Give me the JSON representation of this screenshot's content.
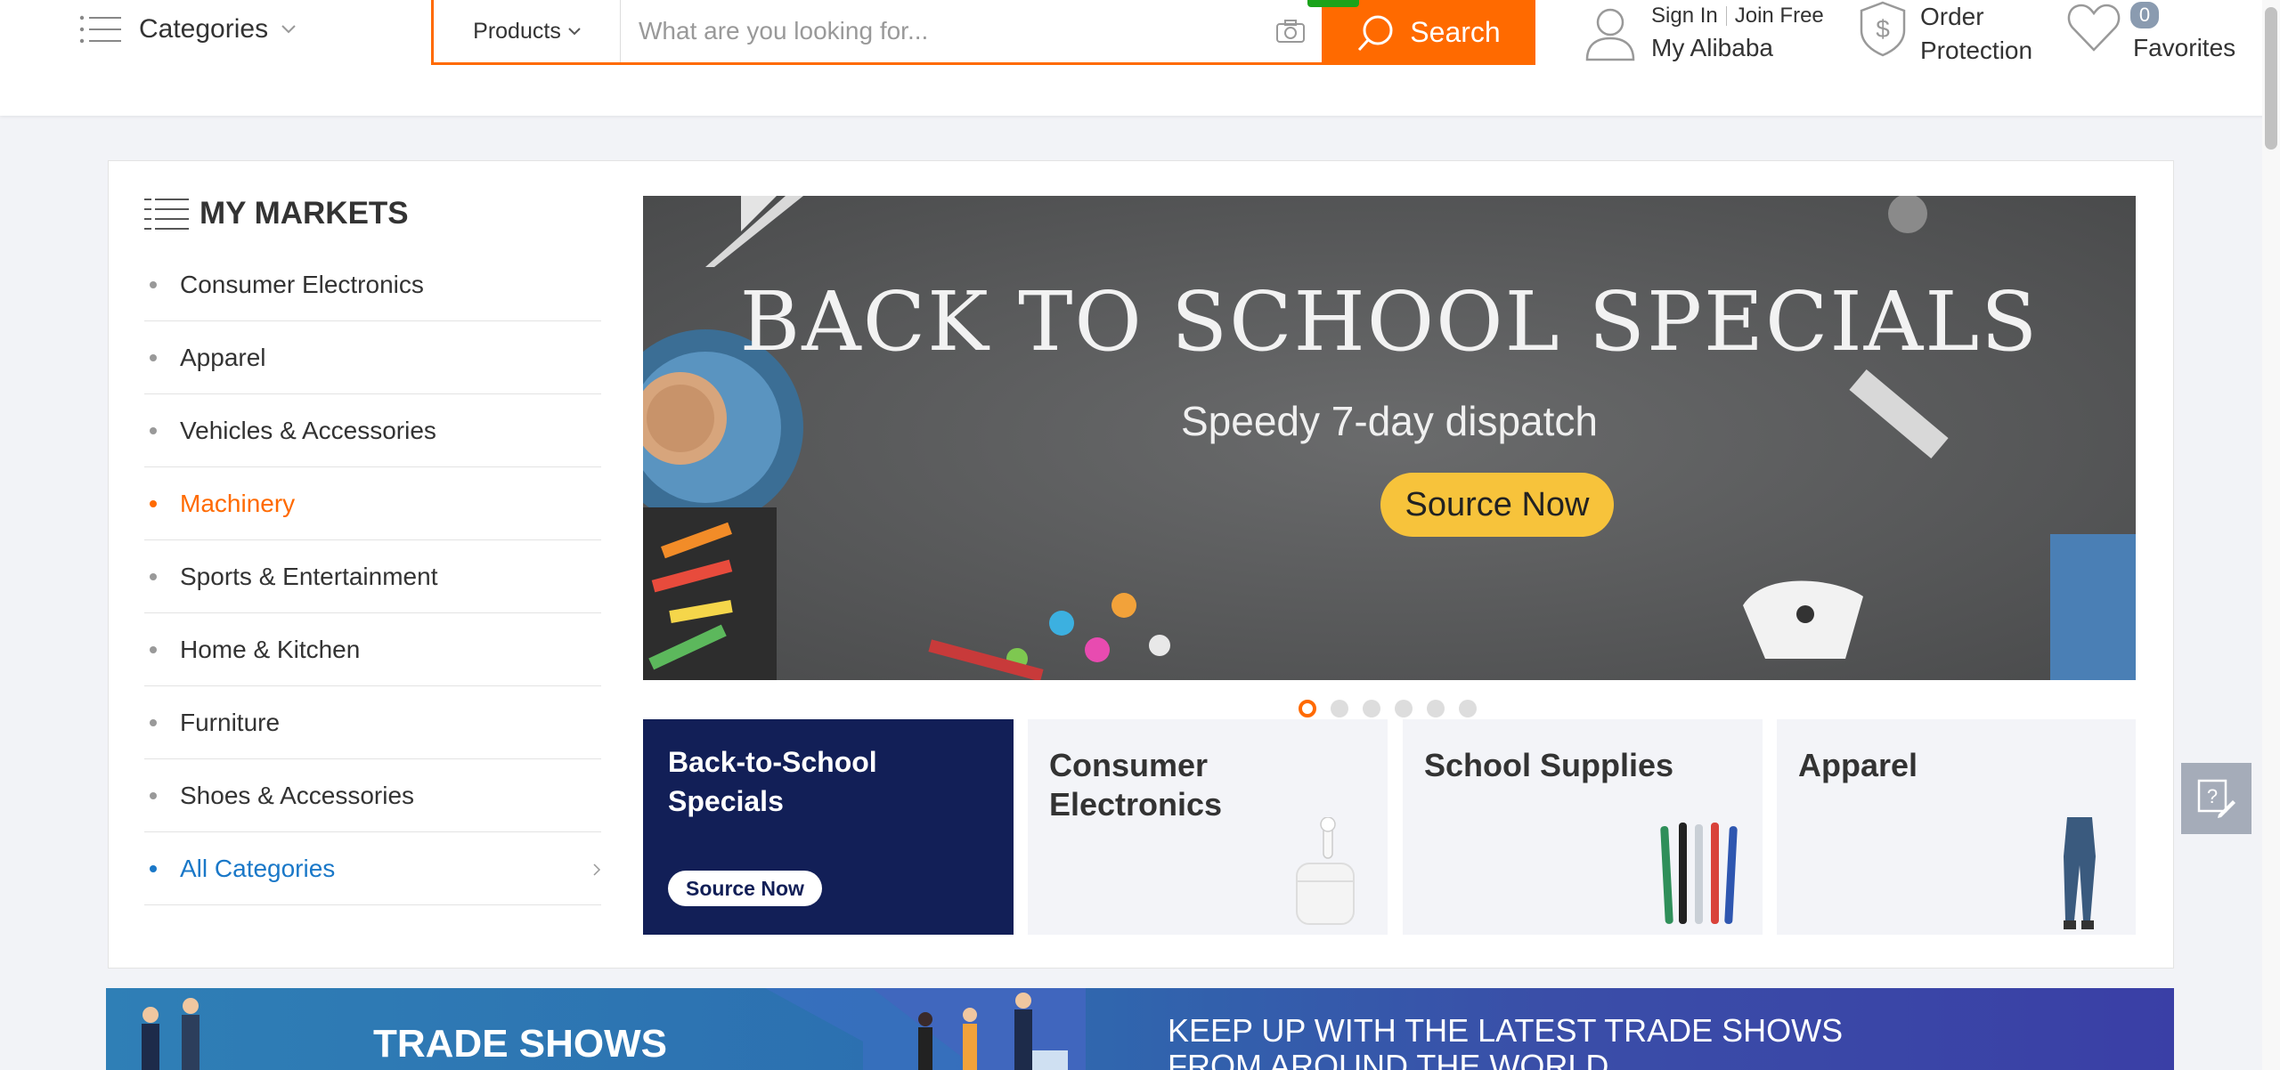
{
  "header": {
    "categories_label": "Categories",
    "search_type": "Products",
    "search_placeholder": "What are you looking for...",
    "search_button": "Search",
    "sign_in": "Sign In",
    "join_free": "Join Free",
    "my_alibaba": "My Alibaba",
    "order_protection_line1": "Order",
    "order_protection_line2": "Protection",
    "favorites_label": "Favorites",
    "favorites_count": "0"
  },
  "markets": {
    "title": "MY MARKETS",
    "items": [
      {
        "label": "Consumer Electronics"
      },
      {
        "label": "Apparel"
      },
      {
        "label": "Vehicles & Accessories"
      },
      {
        "label": "Machinery"
      },
      {
        "label": "Sports & Entertainment"
      },
      {
        "label": "Home & Kitchen"
      },
      {
        "label": "Furniture"
      },
      {
        "label": "Shoes & Accessories"
      },
      {
        "label": "All Categories"
      }
    ],
    "active_index": 3
  },
  "banner": {
    "title": "BACK TO SCHOOL SPECIALS",
    "subtitle": "Speedy 7-day dispatch",
    "cta": "Source Now",
    "slide_count": 6,
    "active_slide": 1
  },
  "tiles": [
    {
      "title": "Back-to-School Specials",
      "button": "Source Now"
    },
    {
      "title": "Consumer Electronics"
    },
    {
      "title": "School Supplies"
    },
    {
      "title": "Apparel"
    }
  ],
  "trade_shows": {
    "title": "TRADE SHOWS",
    "description": "KEEP UP WITH THE LATEST TRADE SHOWS FROM AROUND THE WORLD"
  },
  "colors": {
    "accent": "#ff6a00",
    "link": "#1a78c8",
    "navy": "#121f57"
  }
}
